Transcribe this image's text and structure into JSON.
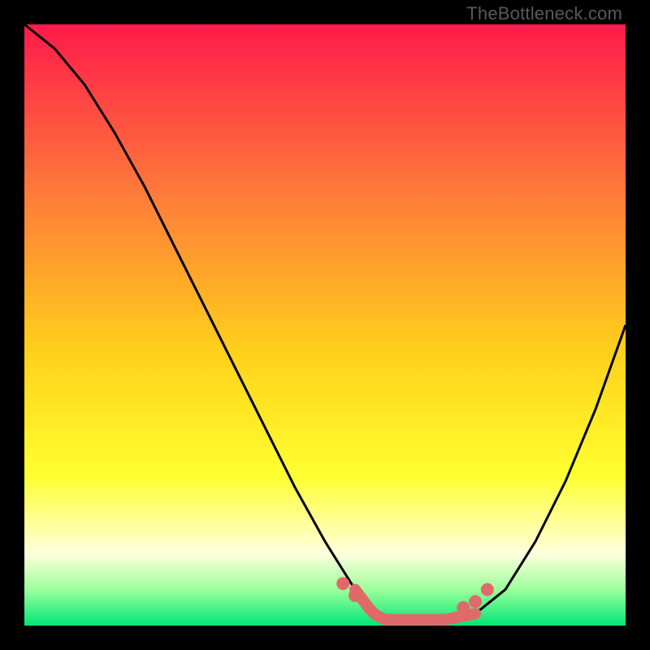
{
  "watermark": "TheBottleneck.com",
  "colors": {
    "top": "#ff1a4b",
    "mid1": "#ff7a3a",
    "mid2": "#ffd21a",
    "mid3": "#ffff30",
    "cream": "#ffffdd",
    "green1": "#9cff9c",
    "green2": "#00e676",
    "curve": "#000000",
    "marker": "#e06a6a"
  },
  "chart_data": {
    "type": "line",
    "title": "",
    "xlabel": "",
    "ylabel": "",
    "xlim": [
      0,
      100
    ],
    "ylim": [
      0,
      100
    ],
    "series": [
      {
        "name": "bottleneck-curve",
        "x": [
          0,
          5,
          10,
          15,
          20,
          25,
          30,
          35,
          40,
          45,
          50,
          55,
          58,
          60,
          65,
          70,
          75,
          80,
          85,
          90,
          95,
          100
        ],
        "y": [
          100,
          96,
          90,
          82,
          73,
          63,
          53,
          43,
          33,
          23,
          14,
          6,
          2,
          1,
          1,
          1,
          2,
          6,
          14,
          24,
          36,
          50
        ]
      }
    ],
    "optimal_range": {
      "x_start": 55,
      "x_end": 75
    },
    "markers": [
      {
        "x": 53,
        "y": 7
      },
      {
        "x": 55,
        "y": 5
      },
      {
        "x": 73,
        "y": 3
      },
      {
        "x": 75,
        "y": 4
      },
      {
        "x": 77,
        "y": 6
      }
    ]
  }
}
